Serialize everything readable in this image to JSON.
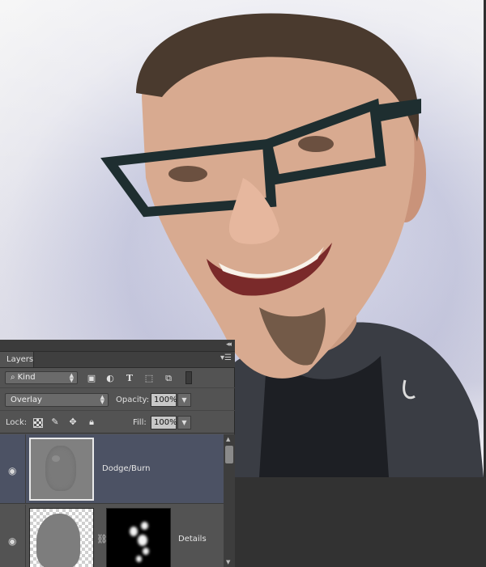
{
  "layers_panel": {
    "tab_label": "Layers",
    "filter": {
      "kind_label": "Kind"
    },
    "blend_mode": "Overlay",
    "opacity_label": "Opacity:",
    "opacity_value": "100%",
    "lock_label": "Lock:",
    "fill_label": "Fill:",
    "fill_value": "100%",
    "layers": [
      {
        "name": "Dodge/Burn",
        "visible": true,
        "selected": true
      },
      {
        "name": "Details",
        "visible": true,
        "selected": false
      }
    ]
  },
  "icons": {
    "filter": [
      "search-icon",
      "image-filter-icon",
      "adjustment-filter-icon",
      "type-filter-icon",
      "shape-filter-icon",
      "smart-object-filter-icon"
    ],
    "lock": [
      "lock-transparent-pixels-icon",
      "lock-image-pixels-icon",
      "lock-position-icon",
      "lock-all-icon"
    ],
    "layer_row": [
      "eye-icon",
      "chain-link-icon"
    ]
  },
  "colors": {
    "panel_bg": "#535353",
    "selected_layer_bg": "#4c5264",
    "canvas_bg": "#e4e4ec"
  }
}
